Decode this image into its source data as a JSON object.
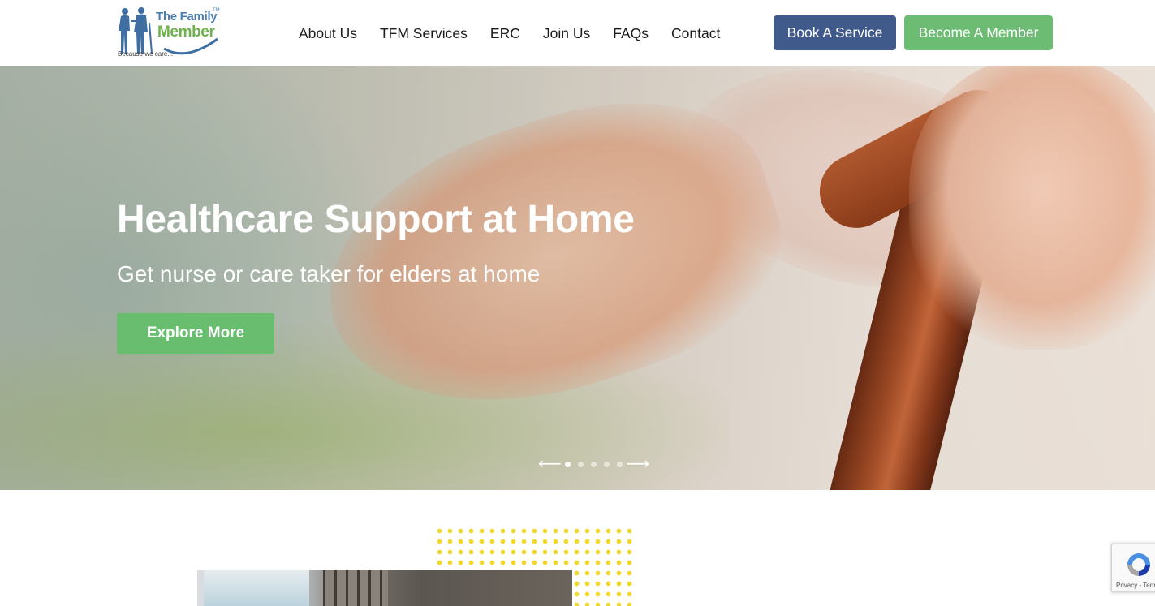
{
  "header": {
    "logo": {
      "line1": "The Family",
      "line2": "Member",
      "tm": "TM",
      "tagline": "Because we care..."
    },
    "nav": [
      "About Us",
      "TFM Services",
      "ERC",
      "Join Us",
      "FAQs",
      "Contact"
    ],
    "book_label": "Book A Service",
    "member_label": "Become A Member",
    "colors": {
      "book": "#405a8c",
      "member": "#6cbd73"
    }
  },
  "hero": {
    "title": "Healthcare Support at Home",
    "subtitle": "Get nurse or care taker for elders at home",
    "button_label": "Explore More",
    "slider": {
      "prev_arrow": "⟵",
      "next_arrow": "⟶",
      "slide_count": 5,
      "active_index": 0
    }
  },
  "recaptcha": {
    "links": "Privacy - Terms",
    "icon": "recaptcha-icon"
  }
}
